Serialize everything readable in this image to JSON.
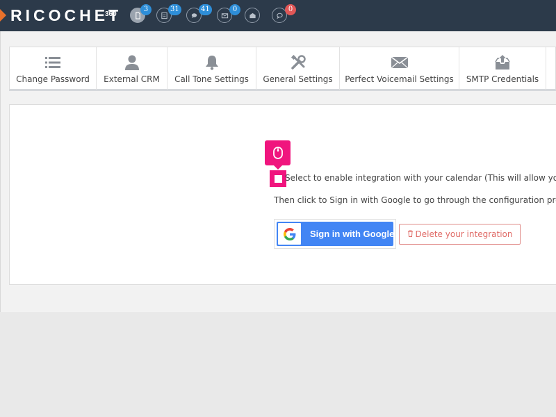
{
  "app": {
    "brand": "RICOCHET",
    "brand_sup": "360"
  },
  "topbar": {
    "icons": [
      {
        "icon": "document-icon",
        "badge": "3",
        "badge_color": "#2e8ed8"
      },
      {
        "icon": "phone-list-icon",
        "badge": "31",
        "badge_color": "#2e8ed8"
      },
      {
        "icon": "chat-icon",
        "badge": "41",
        "badge_color": "#2e8ed8"
      },
      {
        "icon": "mail-icon",
        "badge": "0",
        "badge_color": "#2e8ed8"
      },
      {
        "icon": "mail-open-icon"
      },
      {
        "icon": "speech-bubble-icon",
        "badge": "0",
        "badge_color": "#e15757"
      }
    ]
  },
  "tabs": [
    {
      "label": "Change Password",
      "icon": "list-icon"
    },
    {
      "label": "External CRM",
      "icon": "user-icon"
    },
    {
      "label": "Call Tone Settings",
      "icon": "bell-icon"
    },
    {
      "label": "General Settings",
      "icon": "tools-icon"
    },
    {
      "label": "Perfect Voicemail Settings",
      "icon": "envelope-icon"
    },
    {
      "label": "SMTP Credentials",
      "icon": "inbox-upload-icon"
    }
  ],
  "calendar": {
    "checkbox_label": "Select to enable integration with your calendar (This will allow you to c",
    "instruction": "Then click to Sign in with Google to go through the configuration process",
    "google_button": "Sign in with Google",
    "delete_button": "Delete your integration"
  },
  "colors": {
    "topbar": "#2c3a4a",
    "highlight": "#f0157e",
    "google_blue": "#4285f4",
    "danger": "#e06b67"
  }
}
